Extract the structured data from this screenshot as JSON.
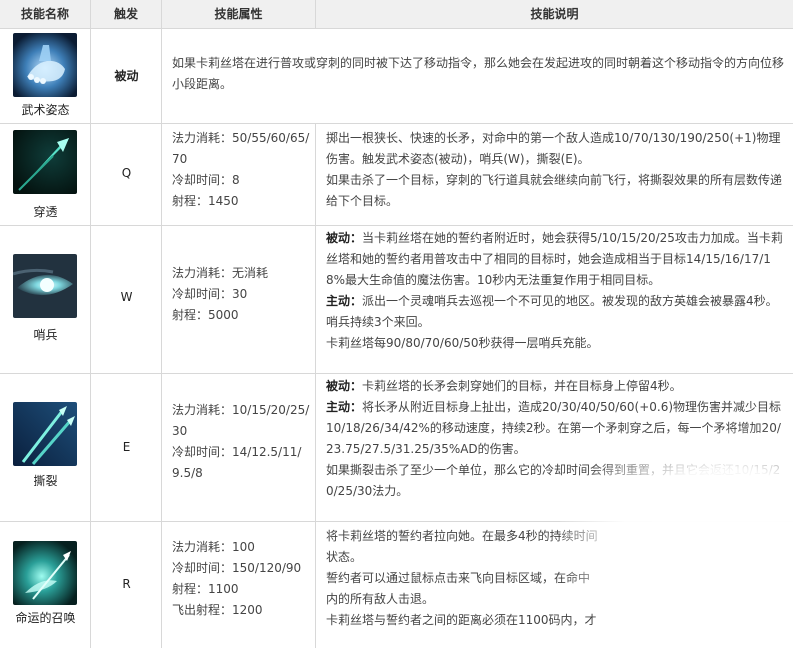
{
  "header": {
    "col_name": "技能名称",
    "col_trigger": "触发",
    "col_attr": "技能属性",
    "col_desc": "技能说明"
  },
  "skills": [
    {
      "name": "武术姿态",
      "icon": "foot-icon",
      "trigger": "被动",
      "desc_lines": [
        "如果卡莉丝塔在进行普攻或穿刺的同时被下达了移动指令，那么她会在发起进攻的同时朝着这个移动指令的方向位移小段距离。"
      ]
    },
    {
      "name": "穿透",
      "icon": "spear-icon",
      "trigger": "Q",
      "attr_lines": [
        "法力消耗：50/55/60/65/70",
        "冷却时间：8",
        "射程：1450"
      ],
      "desc_lines": [
        "掷出一根狭长、快速的长矛，对命中的第一个敌人造成10/70/130/190/250(+1)物理伤害。触发武术姿态(被动)，哨兵(W)，撕裂(E)。",
        "如果击杀了一个目标，穿刺的飞行道具就会继续向前飞行，将撕裂效果的所有层数传递给下个目标。"
      ]
    },
    {
      "name": "哨兵",
      "icon": "eye-icon",
      "trigger": "W",
      "attr_lines": [
        "法力消耗：无消耗",
        "冷却时间：30",
        "射程：5000"
      ],
      "desc_passive_label": "被动：",
      "desc_passive": "当卡莉丝塔在她的誓约者附近时，她会获得5/10/15/20/25攻击力加成。当卡莉丝塔和她的誓约者用普攻击中了相同的目标时，她会造成相当于目标14/15/16/17/18%最大生命值的魔法伤害。10秒内无法重复作用于相同目标。",
      "desc_active_label": "主动：",
      "desc_active": "派出一个灵魂哨兵去巡视一个不可见的地区。被发现的敌方英雄会被暴露4秒。哨兵持续3个来回。",
      "desc_extra": "卡莉丝塔每90/80/70/60/50秒获得一层哨兵充能。"
    },
    {
      "name": "撕裂",
      "icon": "spears-icon",
      "trigger": "E",
      "attr_lines": [
        "法力消耗：10/15/20/25/30",
        "冷却时间：14/12.5/11/9.5/8"
      ],
      "desc_passive_label": "被动：",
      "desc_passive": "卡莉丝塔的长矛会刺穿她们的目标，并在目标身上停留4秒。",
      "desc_active_label": "主动：",
      "desc_active": "将长矛从附近目标身上扯出，造成20/30/40/50/60(+0.6)物理伤害并减少目标10/18/26/34/42%的移动速度，持续2秒。在第一个矛刺穿之后，每一个矛将增加20/23.75/27.5/31.25/35%AD的伤害。",
      "desc_extra": "如果撕裂击杀了至少一个单位，那么它的冷却时间会得到重置，并且它会返还10/15/20/25/30法力。"
    },
    {
      "name": "命运的召唤",
      "icon": "summon-icon",
      "trigger": "R",
      "attr_lines": [
        "法力消耗：100",
        "冷却时间：150/120/90",
        "射程：1100",
        "飞出射程：1200"
      ],
      "desc_lines": [
        "将卡莉丝塔的誓约者拉向她。在最多4秒的持续时间",
        "状态。",
        "誓约者可以通过鼠标点击来飞向目标区域，在命中",
        "内的所有敌人击退。",
        "卡莉丝塔与誓约者之间的距离必须在1100码内，才"
      ]
    }
  ]
}
